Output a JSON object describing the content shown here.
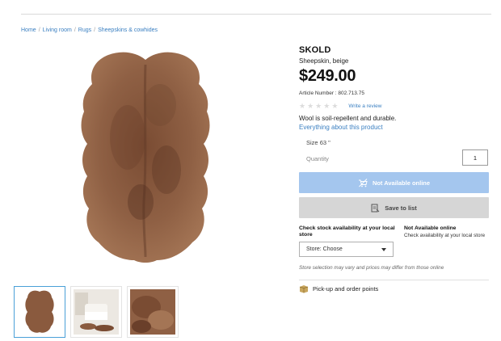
{
  "breadcrumb": {
    "items": [
      "Home",
      "Living room",
      "Rugs",
      "Sheepskins & cowhides"
    ],
    "separator": "/"
  },
  "product": {
    "name": "SKOLD",
    "description": "Sheepskin, beige",
    "price": "$249.00",
    "article_label": "Article Number :",
    "article_number": "802.713.75",
    "rating_stars": 0,
    "review_link": "Write a review",
    "feature_text": "Wool is soil-repellent and durable.",
    "feature_link": "Everything about this product",
    "size_label": "Size",
    "size_value": "63 \""
  },
  "quantity": {
    "label": "Quantity",
    "value": "1"
  },
  "buttons": {
    "not_available": "Not Available online",
    "save_to_list": "Save to list"
  },
  "stock": {
    "title": "Check stock availability at your local store",
    "store_label": "Store:",
    "store_value": "Choose"
  },
  "availability": {
    "title": "Not Available online",
    "text": "Check availability at your local store"
  },
  "disclaimer": "Store selection may vary and prices may differ from those online",
  "pickup": "Pick-up and order points",
  "icons": {
    "rating": "star-icon",
    "cart": "cart-disabled-icon",
    "list": "list-icon",
    "caret": "chevron-down-icon",
    "pickup": "box-icon"
  },
  "colors": {
    "link": "#3a7fc1",
    "button_disabled": "#a4c6ee",
    "button_save": "#d6d6d6",
    "fur": "#8a5a3e"
  }
}
